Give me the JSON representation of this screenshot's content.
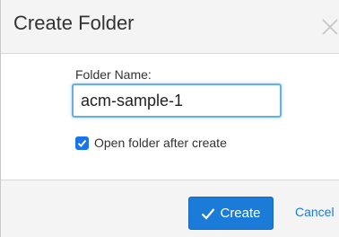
{
  "dialog": {
    "title": "Create Folder",
    "close_icon": "close-icon"
  },
  "form": {
    "folder_name_label": "Folder Name:",
    "folder_name_value": "acm-sample-1",
    "open_after_create_label": "Open folder after create",
    "open_after_create_checked": true
  },
  "footer": {
    "create_label": "Create",
    "create_icon": "check-icon",
    "cancel_label": "Cancel"
  },
  "colors": {
    "accent": "#1a7bd8",
    "header_bg": "#f4f4f4",
    "focus_border": "#66afe9"
  }
}
